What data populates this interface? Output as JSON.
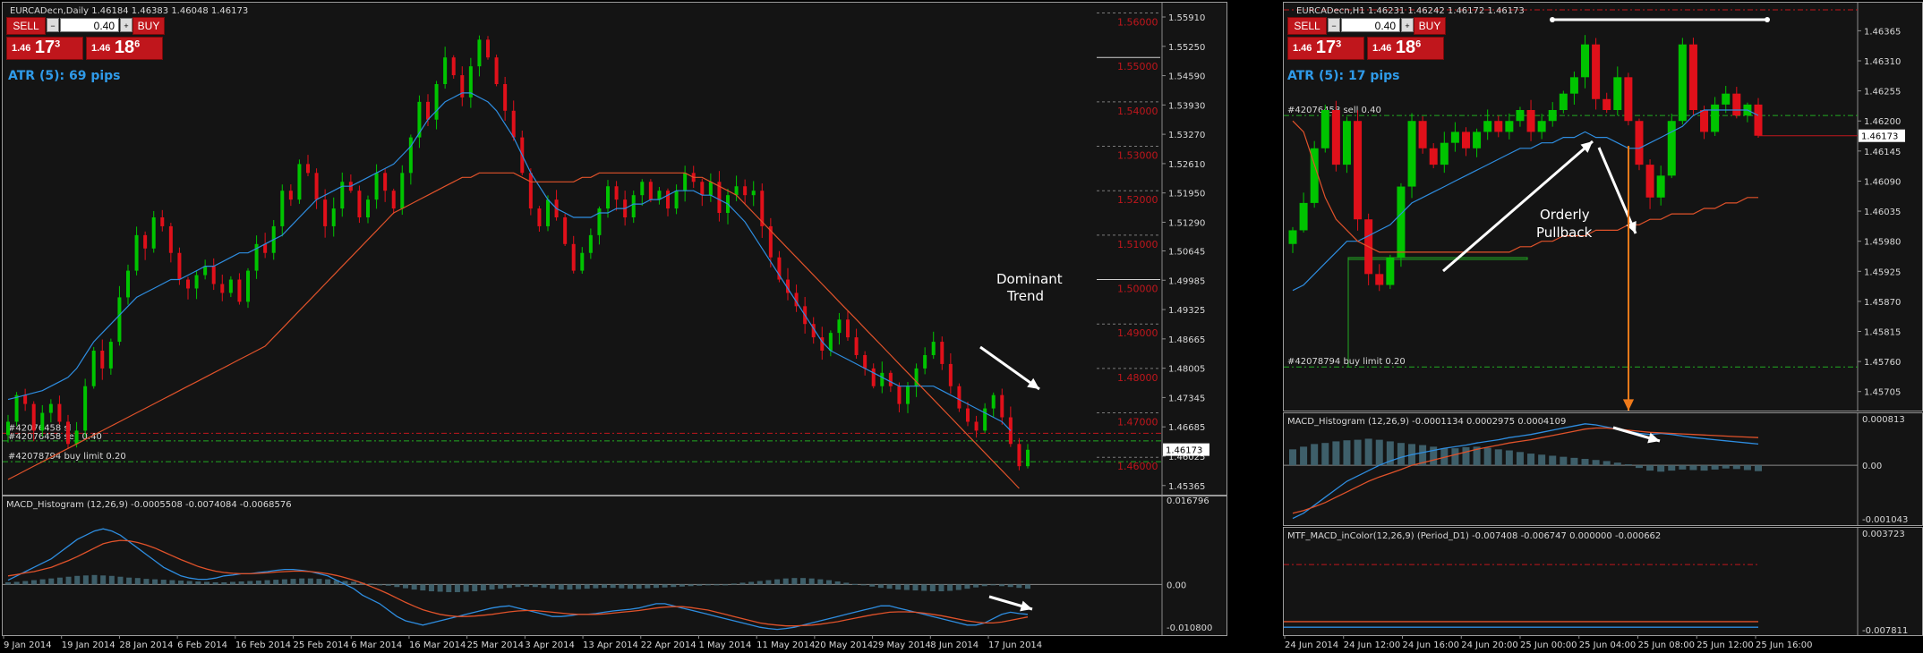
{
  "colors": {
    "bg": "#141414",
    "bull": "#00c400",
    "bear": "#e0101a",
    "ma_fast": "#2e8de0",
    "ma_slow": "#e0522a",
    "macd_bar": "#3e5f6a",
    "text": "#d8d8d8",
    "level": "#c0161c",
    "atr": "#2f9ae8",
    "order_green": "#22aa22",
    "order_red": "#c0161c",
    "arrow": "#ffffff",
    "arrow_orange": "#f07a1a"
  },
  "panels": {
    "daily": {
      "symbol_header": "EURCADecn,Daily  1.46184 1.46383 1.46048 1.46173",
      "atr_label": "ATR (5): 69 pips",
      "trade": {
        "sell": "SELL",
        "buy": "BUY",
        "lot": "0.40",
        "sell_price_small": "1.46",
        "sell_price_big": "17",
        "sell_price_pip": "3",
        "buy_price_small": "1.46",
        "buy_price_big": "18",
        "buy_price_pip": "6"
      },
      "annotation_trend": [
        "Dominant",
        "Trend"
      ],
      "order_labels": {
        "sl": "#42076458 sl",
        "sell": "#42076458 sell 0.40",
        "buy_limit": "#42078794 buy limit 0.20"
      },
      "current_price": "1.46173",
      "macd_header": "MACD_Histogram (12,26,9) -0.0005508 -0.0074084 -0.0068576",
      "macd_axis": [
        "0.016796",
        "0.00",
        "-0.010800"
      ]
    },
    "hourly": {
      "symbol_header": "EURCADecn,H1  1.46231 1.46242 1.46172 1.46173",
      "atr_label": "ATR (5): 17 pips",
      "trade": {
        "sell": "SELL",
        "buy": "BUY",
        "lot": "0.40",
        "sell_price_small": "1.46",
        "sell_price_big": "17",
        "sell_price_pip": "3",
        "buy_price_small": "1.46",
        "buy_price_big": "18",
        "buy_price_pip": "6"
      },
      "annotation_pullback": [
        "Orderly",
        "Pullback"
      ],
      "order_labels": {
        "sell": "#42076458 sell 0.40",
        "buy_limit": "#42078794 buy limit 0.20"
      },
      "current_price": "1.46173",
      "macd_header": "MACD_Histogram (12,26,9) -0.0001134 0.0002975 0.0004109",
      "macd_axis": [
        "0.000813",
        "0.00",
        "-0.001043"
      ],
      "mtf_header": "MTF_MACD_inColor(12,26,9) (Period_D1) -0.007408 -0.006747 0.000000 -0.000662",
      "mtf_axis": [
        "0.003723",
        "-0.007811"
      ]
    }
  },
  "chart_data": [
    {
      "type": "candlestick",
      "name": "EURCADecn,Daily",
      "price_axis": [
        "1.55910",
        "1.55250",
        "1.54590",
        "1.53930",
        "1.53270",
        "1.52610",
        "1.51950",
        "1.51290",
        "1.50645",
        "1.49985",
        "1.49325",
        "1.48665",
        "1.48005",
        "1.47345",
        "1.46685",
        "1.46025",
        "1.45365"
      ],
      "ylim": [
        1.4536,
        1.5591
      ],
      "level_labels": [
        "1.56000",
        "1.55000",
        "1.54000",
        "1.53000",
        "1.52000",
        "1.51000",
        "1.50000",
        "1.49000",
        "1.48000",
        "1.47000",
        "1.46000"
      ],
      "time_labels": [
        "9 Jan 2014",
        "19 Jan 2014",
        "28 Jan 2014",
        "6 Feb 2014",
        "16 Feb 2014",
        "25 Feb 2014",
        "6 Mar 2014",
        "16 Mar 2014",
        "25 Mar 2014",
        "3 Apr 2014",
        "13 Apr 2014",
        "22 Apr 2014",
        "1 May 2014",
        "11 May 2014",
        "20 May 2014",
        "29 May 2014",
        "8 Jun 2014",
        "17 Jun 2014"
      ],
      "closes": [
        1.468,
        1.474,
        1.472,
        1.466,
        1.47,
        1.472,
        1.468,
        1.463,
        1.466,
        1.476,
        1.484,
        1.48,
        1.486,
        1.496,
        1.502,
        1.51,
        1.507,
        1.514,
        1.512,
        1.506,
        1.5,
        1.498,
        1.501,
        1.503,
        1.499,
        1.497,
        1.5,
        1.495,
        1.502,
        1.508,
        1.506,
        1.512,
        1.52,
        1.518,
        1.526,
        1.524,
        1.518,
        1.512,
        1.516,
        1.522,
        1.52,
        1.514,
        1.518,
        1.524,
        1.52,
        1.516,
        1.524,
        1.532,
        1.54,
        1.536,
        1.544,
        1.55,
        1.546,
        1.541,
        1.548,
        1.554,
        1.55,
        1.544,
        1.538,
        1.532,
        1.524,
        1.516,
        1.512,
        1.518,
        1.514,
        1.508,
        1.502,
        1.506,
        1.51,
        1.516,
        1.521,
        1.518,
        1.514,
        1.519,
        1.522,
        1.518,
        1.52,
        1.516,
        1.52,
        1.524,
        1.522,
        1.519,
        1.522,
        1.515,
        1.519,
        1.521,
        1.519,
        1.52,
        1.512,
        1.505,
        1.5,
        1.497,
        1.494,
        1.49,
        1.487,
        1.484,
        1.488,
        1.491,
        1.487,
        1.483,
        1.48,
        1.476,
        1.479,
        1.476,
        1.472,
        1.476,
        1.48,
        1.483,
        1.486,
        1.481,
        1.476,
        1.471,
        1.468,
        1.466,
        1.471,
        1.474,
        1.469,
        1.463,
        1.458,
        1.4617
      ],
      "ma_fast": [
        1.473,
        1.4735,
        1.474,
        1.4745,
        1.475,
        1.476,
        1.477,
        1.478,
        1.48,
        1.483,
        1.486,
        1.488,
        1.49,
        1.492,
        1.494,
        1.496,
        1.497,
        1.498,
        1.499,
        1.5,
        1.5,
        1.501,
        1.502,
        1.503,
        1.503,
        1.504,
        1.505,
        1.506,
        1.506,
        1.507,
        1.508,
        1.509,
        1.51,
        1.512,
        1.514,
        1.516,
        1.518,
        1.519,
        1.52,
        1.521,
        1.521,
        1.522,
        1.523,
        1.524,
        1.525,
        1.526,
        1.528,
        1.53,
        1.533,
        1.536,
        1.538,
        1.54,
        1.541,
        1.542,
        1.542,
        1.541,
        1.54,
        1.538,
        1.535,
        1.532,
        1.528,
        1.524,
        1.521,
        1.518,
        1.516,
        1.515,
        1.514,
        1.514,
        1.514,
        1.515,
        1.515,
        1.516,
        1.516,
        1.517,
        1.517,
        1.518,
        1.518,
        1.519,
        1.52,
        1.52,
        1.52,
        1.519,
        1.519,
        1.518,
        1.517,
        1.515,
        1.513,
        1.51,
        1.507,
        1.504,
        1.501,
        1.498,
        1.495,
        1.492,
        1.489,
        1.486,
        1.484,
        1.483,
        1.482,
        1.481,
        1.48,
        1.479,
        1.478,
        1.477,
        1.476,
        1.476,
        1.476,
        1.476,
        1.476,
        1.475,
        1.474,
        1.473,
        1.472,
        1.471,
        1.47,
        1.469,
        1.468,
        1.466
      ],
      "ma_slow": [
        1.455,
        1.456,
        1.457,
        1.458,
        1.459,
        1.46,
        1.461,
        1.462,
        1.463,
        1.464,
        1.465,
        1.466,
        1.467,
        1.468,
        1.469,
        1.47,
        1.471,
        1.472,
        1.473,
        1.474,
        1.475,
        1.476,
        1.477,
        1.478,
        1.479,
        1.48,
        1.481,
        1.482,
        1.483,
        1.484,
        1.485,
        1.487,
        1.489,
        1.491,
        1.493,
        1.495,
        1.497,
        1.499,
        1.501,
        1.503,
        1.505,
        1.507,
        1.509,
        1.511,
        1.513,
        1.515,
        1.516,
        1.517,
        1.518,
        1.519,
        1.52,
        1.521,
        1.522,
        1.523,
        1.523,
        1.524,
        1.524,
        1.524,
        1.524,
        1.524,
        1.523,
        1.522,
        1.522,
        1.522,
        1.522,
        1.522,
        1.522,
        1.523,
        1.523,
        1.524,
        1.524,
        1.524,
        1.524,
        1.524,
        1.524,
        1.524,
        1.524,
        1.524,
        1.524,
        1.524,
        1.523,
        1.523,
        1.522,
        1.521,
        1.52,
        1.519,
        1.517,
        1.515,
        1.513,
        1.511,
        1.509,
        1.507,
        1.505,
        1.503,
        1.501,
        1.499,
        1.497,
        1.495,
        1.493,
        1.491,
        1.489,
        1.487,
        1.485,
        1.483,
        1.481,
        1.479,
        1.477,
        1.475,
        1.473,
        1.471,
        1.469,
        1.467,
        1.465,
        1.463,
        1.461,
        1.459,
        1.457,
        1.455,
        1.453
      ],
      "orders": {
        "sl": 1.4654,
        "sell": 1.4637,
        "buy_limit": 1.459
      },
      "macd_hist": [
        0.5,
        0.6,
        0.8,
        1.0,
        1.2,
        1.4,
        1.6,
        1.8,
        2.0,
        2.1,
        2.2,
        2.1,
        2.0,
        1.8,
        1.6,
        1.5,
        1.3,
        1.2,
        1.1,
        1.0,
        0.9,
        0.8,
        0.7,
        0.6,
        0.5,
        0.5,
        0.6,
        0.7,
        0.8,
        0.9,
        1.0,
        1.1,
        1.2,
        1.3,
        1.4,
        1.4,
        1.3,
        1.2,
        1.0,
        0.8,
        0.6,
        0.4,
        0.2,
        0.0,
        -0.3,
        -0.6,
        -0.9,
        -1.2,
        -1.4,
        -1.6,
        -1.7,
        -1.8,
        -1.8,
        -1.7,
        -1.6,
        -1.4,
        -1.2,
        -1.0,
        -0.8,
        -0.6,
        -0.5,
        -0.6,
        -0.8,
        -1.0,
        -1.2,
        -1.2,
        -1.1,
        -1.0,
        -0.9,
        -0.8,
        -0.8,
        -0.9,
        -1.0,
        -1.0,
        -0.9,
        -0.8,
        -0.7,
        -0.6,
        -0.5,
        -0.4,
        -0.3,
        -0.2,
        -0.1,
        0.0,
        0.2,
        0.4,
        0.6,
        0.8,
        1.0,
        1.2,
        1.4,
        1.5,
        1.5,
        1.4,
        1.2,
        1.0,
        0.7,
        0.4,
        0.1,
        -0.2,
        -0.5,
        -0.8,
        -1.0,
        -1.2,
        -1.3,
        -1.4,
        -1.5,
        -1.6,
        -1.6,
        -1.5,
        -1.3,
        -1.0,
        -0.7,
        -0.4,
        -0.2,
        -0.4,
        -0.6,
        -0.8,
        -1.0
      ],
      "macd_line": [
        1.0,
        2.0,
        3.0,
        4.0,
        5.0,
        6.0,
        7.5,
        9.0,
        10.5,
        11.5,
        12.5,
        13.0,
        12.5,
        11.5,
        10.0,
        8.5,
        7.0,
        5.5,
        4.0,
        3.0,
        2.0,
        1.5,
        1.2,
        1.2,
        1.5,
        2.0,
        2.2,
        2.5,
        2.5,
        2.8,
        3.0,
        3.3,
        3.5,
        3.5,
        3.3,
        3.0,
        2.5,
        2.0,
        1.0,
        0.0,
        -1.0,
        -2.5,
        -3.5,
        -4.5,
        -6.0,
        -7.5,
        -8.5,
        -9.0,
        -9.5,
        -9.0,
        -8.5,
        -8.0,
        -7.5,
        -7.0,
        -6.5,
        -6.0,
        -5.5,
        -5.2,
        -5.0,
        -5.5,
        -6.0,
        -6.5,
        -7.0,
        -7.5,
        -7.5,
        -7.3,
        -7.0,
        -7.0,
        -6.8,
        -6.5,
        -6.2,
        -6.0,
        -5.8,
        -5.5,
        -5.0,
        -4.5,
        -4.5,
        -5.0,
        -5.5,
        -6.0,
        -6.5,
        -7.0,
        -7.5,
        -8.0,
        -8.5,
        -9.0,
        -9.5,
        -10.0,
        -10.3,
        -10.5,
        -10.3,
        -10.0,
        -9.5,
        -9.0,
        -8.5,
        -8.0,
        -7.5,
        -7.0,
        -6.5,
        -6.0,
        -5.5,
        -5.0,
        -5.0,
        -5.5,
        -6.0,
        -6.5,
        -7.0,
        -7.5,
        -8.0,
        -8.5,
        -9.0,
        -9.5,
        -9.5,
        -9.0,
        -8.0,
        -7.0,
        -6.5,
        -6.8,
        -7.0
      ],
      "macd_signal": [
        2.0,
        2.3,
        2.7,
        3.0,
        3.5,
        4.0,
        4.8,
        5.6,
        6.5,
        7.5,
        8.5,
        9.5,
        10.0,
        10.3,
        10.2,
        9.8,
        9.2,
        8.5,
        7.6,
        6.7,
        5.8,
        5.0,
        4.2,
        3.6,
        3.1,
        2.8,
        2.6,
        2.5,
        2.5,
        2.6,
        2.7,
        2.9,
        3.0,
        3.1,
        3.1,
        3.0,
        2.8,
        2.5,
        2.1,
        1.6,
        1.0,
        0.3,
        -0.5,
        -1.3,
        -2.2,
        -3.2,
        -4.2,
        -5.1,
        -5.9,
        -6.5,
        -7.0,
        -7.3,
        -7.5,
        -7.5,
        -7.4,
        -7.2,
        -7.0,
        -6.7,
        -6.4,
        -6.2,
        -6.1,
        -6.1,
        -6.3,
        -6.5,
        -6.7,
        -6.9,
        -7.0,
        -7.0,
        -7.0,
        -6.9,
        -6.7,
        -6.5,
        -6.3,
        -6.1,
        -5.8,
        -5.5,
        -5.3,
        -5.2,
        -5.2,
        -5.4,
        -5.7,
        -6.0,
        -6.5,
        -7.0,
        -7.5,
        -8.0,
        -8.5,
        -9.0,
        -9.3,
        -9.5,
        -9.7,
        -9.7,
        -9.6,
        -9.5,
        -9.3,
        -9.0,
        -8.7,
        -8.3,
        -7.9,
        -7.5,
        -7.1,
        -6.8,
        -6.5,
        -6.4,
        -6.4,
        -6.5,
        -6.7,
        -7.0,
        -7.3,
        -7.7,
        -8.1,
        -8.5,
        -8.8,
        -9.0,
        -9.0,
        -8.8,
        -8.4,
        -8.0,
        -7.6
      ]
    },
    {
      "type": "candlestick",
      "name": "EURCADecn,H1",
      "price_axis": [
        "1.46365",
        "1.46310",
        "1.46255",
        "1.46200",
        "1.46145",
        "1.46090",
        "1.46035",
        "1.45980",
        "1.45925",
        "1.45870",
        "1.45815",
        "1.45760",
        "1.45705"
      ],
      "ylim": [
        1.4568,
        1.464
      ],
      "current_axis_label": "1.46173",
      "time_labels": [
        "24 Jun 2014",
        "24 Jun 12:00",
        "24 Jun 16:00",
        "24 Jun 20:00",
        "25 Jun 00:00",
        "25 Jun 04:00",
        "25 Jun 08:00",
        "25 Jun 12:00",
        "25 Jun 16:00"
      ],
      "closes": [
        1.46,
        1.4605,
        1.4615,
        1.4622,
        1.4612,
        1.462,
        1.4602,
        1.4592,
        1.459,
        1.4595,
        1.4608,
        1.462,
        1.4615,
        1.4612,
        1.4616,
        1.4618,
        1.4615,
        1.4618,
        1.462,
        1.4618,
        1.462,
        1.4622,
        1.4618,
        1.462,
        1.4622,
        1.4625,
        1.4628,
        1.4634,
        1.4624,
        1.4622,
        1.4628,
        1.462,
        1.4612,
        1.4606,
        1.461,
        1.462,
        1.4634,
        1.4622,
        1.4618,
        1.4623,
        1.4625,
        1.4621,
        1.4623,
        1.46173
      ],
      "ma_fast": [
        1.4589,
        1.459,
        1.4592,
        1.4594,
        1.4596,
        1.4598,
        1.4598,
        1.4599,
        1.46,
        1.4601,
        1.4603,
        1.4605,
        1.4606,
        1.4607,
        1.4608,
        1.4609,
        1.461,
        1.4611,
        1.4612,
        1.4613,
        1.4614,
        1.4615,
        1.4615,
        1.4616,
        1.4616,
        1.4617,
        1.4617,
        1.4618,
        1.4617,
        1.4617,
        1.4616,
        1.4615,
        1.4615,
        1.4616,
        1.4617,
        1.4618,
        1.4619,
        1.4621,
        1.4622,
        1.4622,
        1.4622,
        1.4622,
        1.4622,
        1.4621
      ],
      "ma_slow": [
        1.462,
        1.4618,
        1.4612,
        1.4606,
        1.4602,
        1.46,
        1.4598,
        1.4597,
        1.4596,
        1.4596,
        1.4596,
        1.4596,
        1.4596,
        1.4596,
        1.4596,
        1.4596,
        1.4596,
        1.4596,
        1.4596,
        1.4596,
        1.4596,
        1.4597,
        1.4597,
        1.4598,
        1.4598,
        1.4599,
        1.4599,
        1.4599,
        1.46,
        1.46,
        1.46,
        1.4601,
        1.4601,
        1.4602,
        1.4602,
        1.4603,
        1.4603,
        1.4603,
        1.4604,
        1.4604,
        1.4605,
        1.4605,
        1.4606,
        1.4606
      ],
      "orders": {
        "sell": 1.4621,
        "buy_limit": 1.4575
      },
      "resistance": 1.4638,
      "macd_hist": [
        0.3,
        0.35,
        0.4,
        0.42,
        0.45,
        0.47,
        0.48,
        0.5,
        0.48,
        0.45,
        0.42,
        0.4,
        0.38,
        0.35,
        0.32,
        0.32,
        0.34,
        0.35,
        0.33,
        0.3,
        0.28,
        0.25,
        0.22,
        0.2,
        0.18,
        0.16,
        0.14,
        0.12,
        0.1,
        0.08,
        0.05,
        0.02,
        -0.05,
        -0.1,
        -0.12,
        -0.1,
        -0.08,
        -0.09,
        -0.1,
        -0.08,
        -0.06,
        -0.07,
        -0.09,
        -0.11
      ],
      "macd_line": [
        -1.0,
        -0.9,
        -0.75,
        -0.6,
        -0.45,
        -0.3,
        -0.2,
        -0.1,
        0.0,
        0.08,
        0.15,
        0.2,
        0.24,
        0.28,
        0.32,
        0.35,
        0.38,
        0.42,
        0.45,
        0.48,
        0.52,
        0.55,
        0.58,
        0.62,
        0.66,
        0.7,
        0.74,
        0.78,
        0.76,
        0.72,
        0.68,
        0.64,
        0.6,
        0.58,
        0.6,
        0.58,
        0.55,
        0.52,
        0.5,
        0.48,
        0.46,
        0.44,
        0.42,
        0.4
      ],
      "macd_signal": [
        -0.9,
        -0.85,
        -0.78,
        -0.7,
        -0.6,
        -0.5,
        -0.4,
        -0.3,
        -0.22,
        -0.15,
        -0.08,
        0.0,
        0.05,
        0.1,
        0.15,
        0.2,
        0.25,
        0.3,
        0.34,
        0.38,
        0.42,
        0.45,
        0.48,
        0.52,
        0.56,
        0.6,
        0.64,
        0.68,
        0.7,
        0.7,
        0.68,
        0.66,
        0.64,
        0.62,
        0.61,
        0.6,
        0.59,
        0.58,
        0.57,
        0.56,
        0.55,
        0.54,
        0.53,
        0.52
      ],
      "mtf_zero": 0.0,
      "mtf_line_a": -0.007408,
      "mtf_line_b": -0.006747
    }
  ]
}
